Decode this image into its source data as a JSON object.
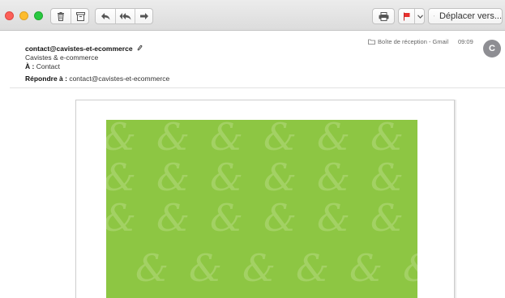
{
  "window": {
    "traffic_lights": [
      "close",
      "minimize",
      "zoom"
    ]
  },
  "toolbar": {
    "icons": {
      "delete": "trash-icon",
      "archive": "archive-icon",
      "reply": "reply-icon",
      "reply_all": "reply-all-icon",
      "forward": "forward-icon",
      "print": "printer-icon",
      "flag": "flag-icon",
      "flag_menu": "chevron-down-icon",
      "move": "move-to-mailbox-icon"
    },
    "flag_color": "#e8312f",
    "move_label": "Déplacer vers..."
  },
  "header": {
    "from": "contact@cavistes-et-ecommerce",
    "organization": "Cavistes & e-commerce",
    "to_label": "À :",
    "to_value": "Contact",
    "reply_to_label": "Répondre à :",
    "reply_to_value": "contact@cavistes-et-ecommerce",
    "mailbox": "Boîte de réception - Gmail",
    "time": "09:09",
    "avatar_initial": "C"
  },
  "message": {
    "banner_color": "#8dc643",
    "pattern_glyph": "&"
  }
}
